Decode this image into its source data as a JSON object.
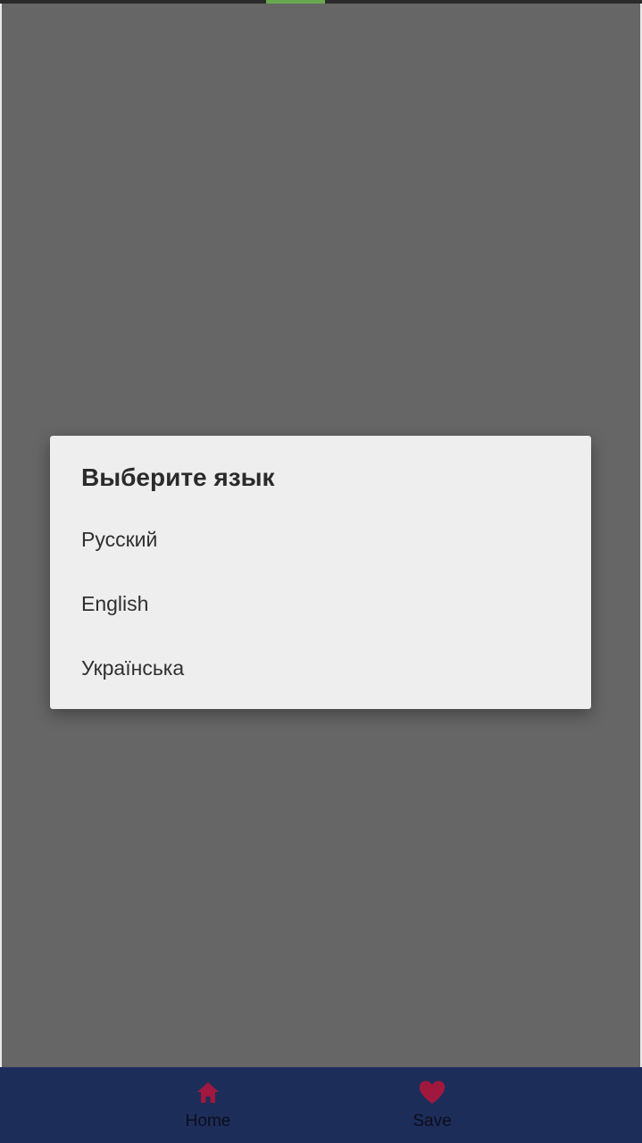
{
  "dialog": {
    "title": "Выберите язык",
    "options": [
      {
        "label": "Русский"
      },
      {
        "label": "English"
      },
      {
        "label": "Українська"
      }
    ]
  },
  "bottom_nav": {
    "items": [
      {
        "label": "Home",
        "icon": "home-icon"
      },
      {
        "label": "Save",
        "icon": "heart-icon"
      }
    ]
  },
  "colors": {
    "scrim": "#666666",
    "dialog_background": "#eeeeee",
    "nav_background": "#1d2d5a",
    "nav_icon": "#a0183e",
    "status_accent": "#6aa84f"
  }
}
